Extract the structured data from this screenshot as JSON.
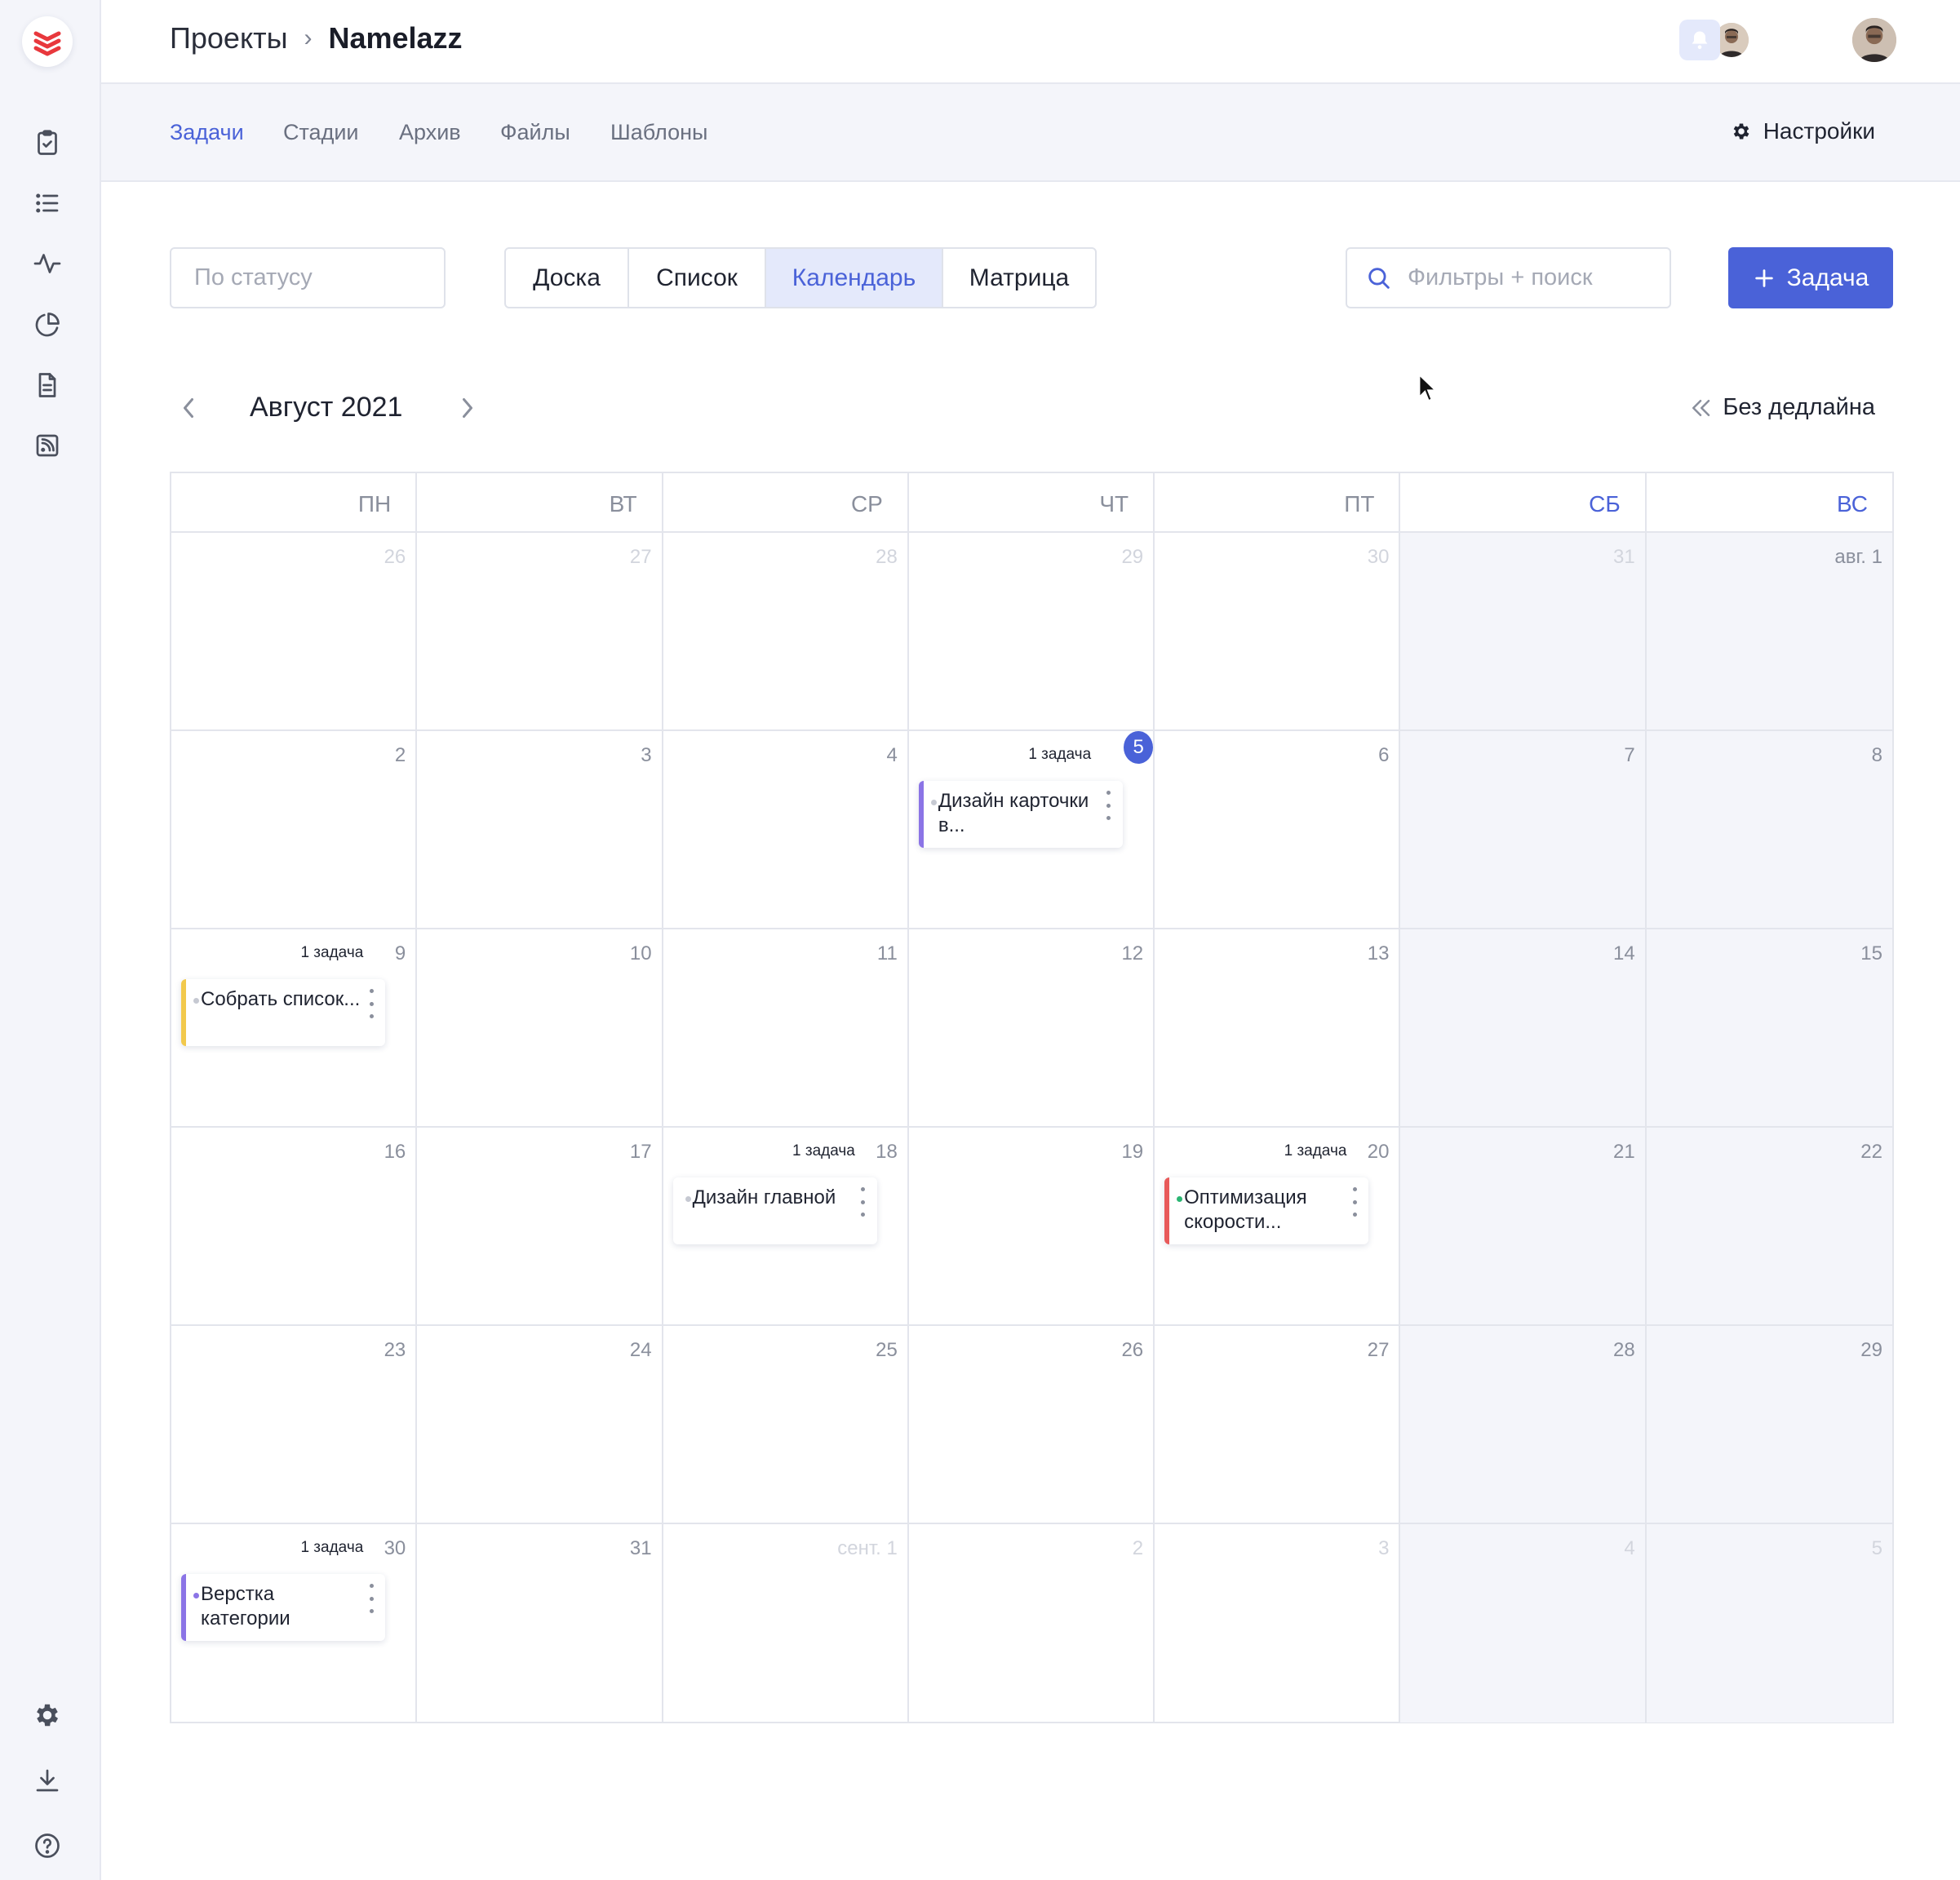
{
  "header": {
    "breadcrumb_root": "Проекты",
    "breadcrumb_sep": "›",
    "project_name": "Namelazz"
  },
  "subnav": {
    "tabs": [
      "Задачи",
      "Стадии",
      "Архив",
      "Файлы",
      "Шаблоны"
    ],
    "active_tab": "Задачи",
    "settings_label": "Настройки"
  },
  "toolbar": {
    "status_placeholder": "По статусу",
    "views": [
      "Доска",
      "Список",
      "Календарь",
      "Матрица"
    ],
    "active_view": "Календарь",
    "search_placeholder": "Фильтры + поиск",
    "add_task_label": "Задача"
  },
  "calendar": {
    "month_title": "Август 2021",
    "no_deadline_label": "Без дедлайна",
    "weekdays": [
      "ПН",
      "ВТ",
      "СР",
      "ЧТ",
      "ПТ",
      "СБ",
      "ВС"
    ],
    "weekend_color": "#4a62d8",
    "accent_color": "#4a62d8",
    "days": [
      {
        "label": "26",
        "other": true
      },
      {
        "label": "27",
        "other": true
      },
      {
        "label": "28",
        "other": true
      },
      {
        "label": "29",
        "other": true
      },
      {
        "label": "30",
        "other": true
      },
      {
        "label": "31",
        "other": true
      },
      {
        "label": "авг. 1",
        "other": false
      },
      {
        "label": "2"
      },
      {
        "label": "3"
      },
      {
        "label": "4"
      },
      {
        "label": "5",
        "today": true,
        "count": "1 задача",
        "task": {
          "title": "Дизайн карточки в...",
          "bar": "#8b74e6",
          "dot": "#c6c9d2"
        }
      },
      {
        "label": "6"
      },
      {
        "label": "7"
      },
      {
        "label": "8"
      },
      {
        "label": "9",
        "count": "1 задача",
        "task": {
          "title": "Собрать список...",
          "bar": "#f2c94c",
          "dot": "#c6c9d2"
        }
      },
      {
        "label": "10"
      },
      {
        "label": "11"
      },
      {
        "label": "12"
      },
      {
        "label": "13"
      },
      {
        "label": "14"
      },
      {
        "label": "15"
      },
      {
        "label": "16"
      },
      {
        "label": "17"
      },
      {
        "label": "18",
        "count": "1 задача",
        "task": {
          "title": "Дизайн главной",
          "bar": "#ffffff",
          "dot": "#c6c9d2"
        }
      },
      {
        "label": "19"
      },
      {
        "label": "20",
        "count": "1 задача",
        "task": {
          "title": "Оптимизация скорости...",
          "bar": "#e85a5a",
          "dot": "#2bb673"
        }
      },
      {
        "label": "21"
      },
      {
        "label": "22"
      },
      {
        "label": "23"
      },
      {
        "label": "24"
      },
      {
        "label": "25"
      },
      {
        "label": "26"
      },
      {
        "label": "27"
      },
      {
        "label": "28"
      },
      {
        "label": "29"
      },
      {
        "label": "30",
        "count": "1 задача",
        "task": {
          "title": "Верстка категории",
          "bar": "#8b74e6",
          "dot": "#8b74e6"
        }
      },
      {
        "label": "31"
      },
      {
        "label": "сент. 1",
        "other": true
      },
      {
        "label": "2",
        "other": true
      },
      {
        "label": "3",
        "other": true
      },
      {
        "label": "4",
        "other": true
      },
      {
        "label": "5",
        "other": true
      }
    ]
  }
}
